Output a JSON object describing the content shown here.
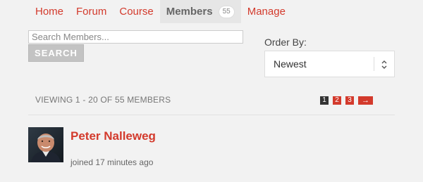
{
  "nav": {
    "tabs": [
      {
        "label": "Home"
      },
      {
        "label": "Forum"
      },
      {
        "label": "Course"
      },
      {
        "label": "Members",
        "count": "55",
        "active": true
      },
      {
        "label": "Manage"
      }
    ]
  },
  "search": {
    "placeholder": "Search Members...",
    "value": "",
    "button_label": "SEARCH"
  },
  "order_by": {
    "label": "Order By:",
    "selected": "Newest"
  },
  "pagination": {
    "viewing_text": "VIEWING 1 - 20 OF 55 MEMBERS",
    "pages": [
      "1",
      "2",
      "3"
    ],
    "current_page": "1",
    "next_label": "→"
  },
  "members": [
    {
      "name": "Peter Nalleweg",
      "joined": "joined 17 minutes ago",
      "avatar_icon": "user-photo"
    }
  ],
  "colors": {
    "accent": "#d33a2c",
    "background": "#f2f2f2",
    "active_tab_bg": "#e6e6e6",
    "current_page_bg": "#333333"
  }
}
